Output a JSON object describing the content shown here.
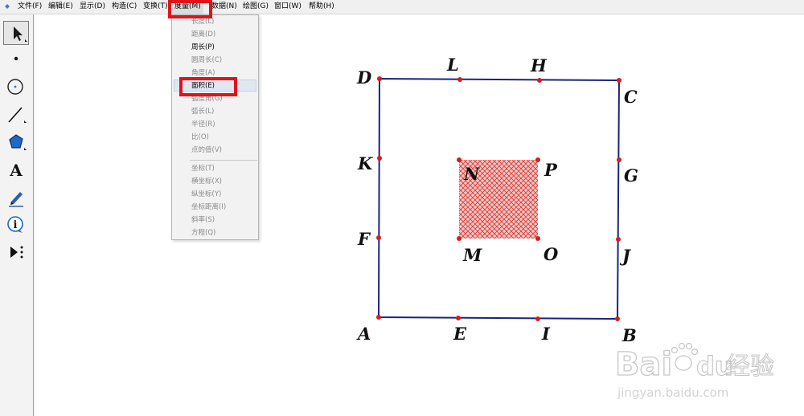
{
  "menubar": {
    "items": [
      {
        "label": "文件(F)"
      },
      {
        "label": "编辑(E)"
      },
      {
        "label": "显示(D)"
      },
      {
        "label": "构造(C)"
      },
      {
        "label": "变换(T)"
      },
      {
        "label": "度量(M)"
      },
      {
        "label": "数据(N)"
      },
      {
        "label": "绘图(G)"
      },
      {
        "label": "窗口(W)"
      },
      {
        "label": "帮助(H)"
      }
    ]
  },
  "dropdown": {
    "items": [
      {
        "label": "长度(L)",
        "enabled": false
      },
      {
        "label": "距离(D)",
        "enabled": false
      },
      {
        "label": "周长(P)",
        "enabled": true
      },
      {
        "label": "圆周长(C)",
        "enabled": false
      },
      {
        "label": "角度(A)",
        "enabled": false
      },
      {
        "label": "面积(E)",
        "enabled": true
      },
      {
        "label": "弧度角(G)",
        "enabled": false
      },
      {
        "label": "弧长(L)",
        "enabled": false
      },
      {
        "label": "半径(R)",
        "enabled": false
      },
      {
        "label": "比(O)",
        "enabled": false
      },
      {
        "label": "点的值(V)",
        "enabled": false
      },
      {
        "label": "坐标(T)",
        "enabled": false
      },
      {
        "label": "横坐标(X)",
        "enabled": false
      },
      {
        "label": "纵坐标(Y)",
        "enabled": false
      },
      {
        "label": "坐标距离(I)",
        "enabled": false
      },
      {
        "label": "斜率(S)",
        "enabled": false
      },
      {
        "label": "方程(Q)",
        "enabled": false
      }
    ]
  },
  "toolbar": {
    "tools": [
      {
        "icon": "arrow-select-icon"
      },
      {
        "icon": "point-icon"
      },
      {
        "icon": "compass-circle-icon"
      },
      {
        "icon": "straightedge-icon"
      },
      {
        "icon": "polygon-icon"
      },
      {
        "icon": "text-icon",
        "glyph": "A"
      },
      {
        "icon": "marker-pen-icon"
      },
      {
        "icon": "information-icon",
        "glyph": "i"
      },
      {
        "icon": "custom-tool-icon"
      }
    ]
  },
  "geometry": {
    "points": {
      "A": "A",
      "B": "B",
      "C": "C",
      "D": "D",
      "E": "E",
      "F": "F",
      "G": "G",
      "H": "H",
      "I": "I",
      "J": "J",
      "K": "K",
      "L": "L",
      "M": "M",
      "N": "N",
      "O": "O",
      "P": "P"
    },
    "colors": {
      "outer_square": "#1a237e",
      "point": "#d81b1b",
      "hatch": "#d9342e",
      "hatch_bg": "#f6c9c7",
      "highlight_box": "#e0121b"
    }
  },
  "watermark": {
    "brand_prefix": "Bai",
    "brand_suffix": "du",
    "brand_cn": "经验",
    "url": "jingyan.baidu.com"
  }
}
